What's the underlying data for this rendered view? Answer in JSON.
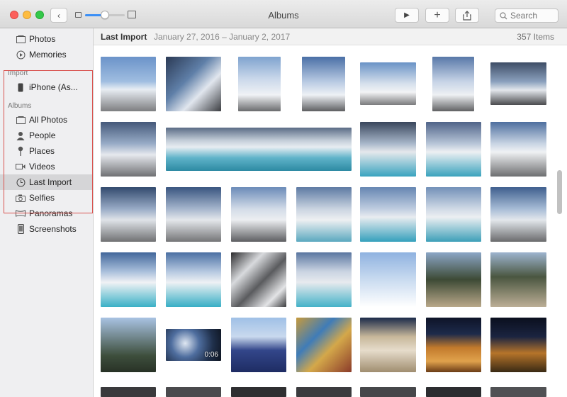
{
  "window": {
    "title": "Albums",
    "search_placeholder": "Search"
  },
  "toolbar": {
    "back": "‹",
    "play": "▶",
    "add": "+",
    "share": "⇪"
  },
  "zoom": {
    "level": 0.5
  },
  "sidebar": {
    "top_items": [
      {
        "label": "Photos",
        "icon": "photos-icon"
      },
      {
        "label": "Memories",
        "icon": "memories-icon"
      }
    ],
    "import_header": "Import",
    "import_items": [
      {
        "label": "iPhone (As...",
        "icon": "iphone-icon"
      }
    ],
    "albums_header": "Albums",
    "albums": [
      {
        "label": "All Photos",
        "icon": "all-photos-icon"
      },
      {
        "label": "People",
        "icon": "people-icon"
      },
      {
        "label": "Places",
        "icon": "places-icon"
      },
      {
        "label": "Videos",
        "icon": "videos-icon"
      },
      {
        "label": "Last Import",
        "icon": "last-import-icon",
        "selected": true
      },
      {
        "label": "Selfies",
        "icon": "selfies-icon"
      },
      {
        "label": "Panoramas",
        "icon": "panoramas-icon"
      },
      {
        "label": "Screenshots",
        "icon": "screenshots-icon"
      }
    ]
  },
  "main": {
    "title": "Last Import",
    "date_range": "January 27, 2016 – January 2, 2017",
    "count": "357 Items",
    "video_duration": "0:06"
  },
  "colors": {
    "accent": "#3b8ff6",
    "highlight_border": "#d9534f",
    "selected_row": "#d5d5d7"
  }
}
